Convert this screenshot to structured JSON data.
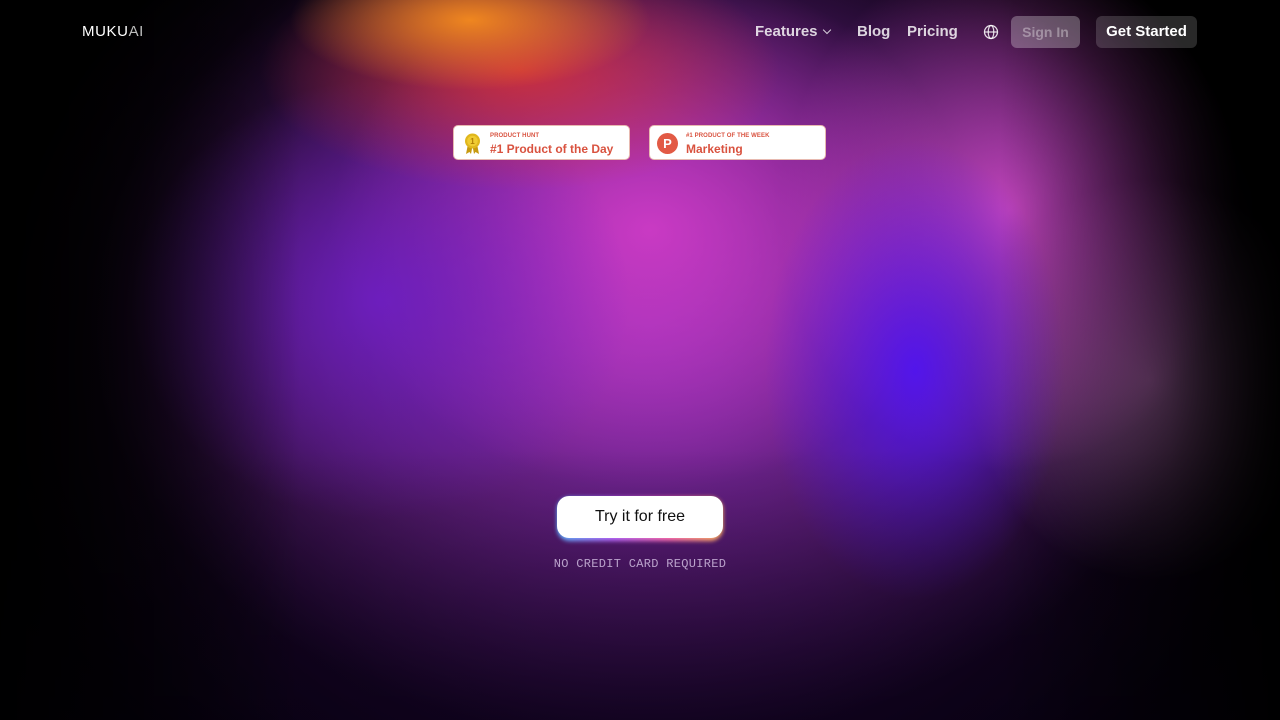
{
  "brand": {
    "logo_main": "MUKU",
    "logo_suffix": "AI"
  },
  "nav": {
    "features": "Features",
    "blog": "Blog",
    "pricing": "Pricing",
    "language_icon": "globe-icon",
    "sign_in": "Sign In",
    "get_started": "Get Started"
  },
  "badges": [
    {
      "icon": "medal-icon",
      "small": "PRODUCT HUNT",
      "big": "#1 Product of the Day"
    },
    {
      "icon": "product-hunt-icon",
      "icon_letter": "P",
      "small": "#1 PRODUCT OF THE WEEK",
      "big": "Marketing"
    }
  ],
  "hero": {
    "cta": "Try it for free",
    "note": "NO CREDIT CARD REQUIRED"
  },
  "colors": {
    "badge_text": "#d9523f",
    "badge_border": "#e7b9b0",
    "cta_bg": "#ffffff"
  }
}
